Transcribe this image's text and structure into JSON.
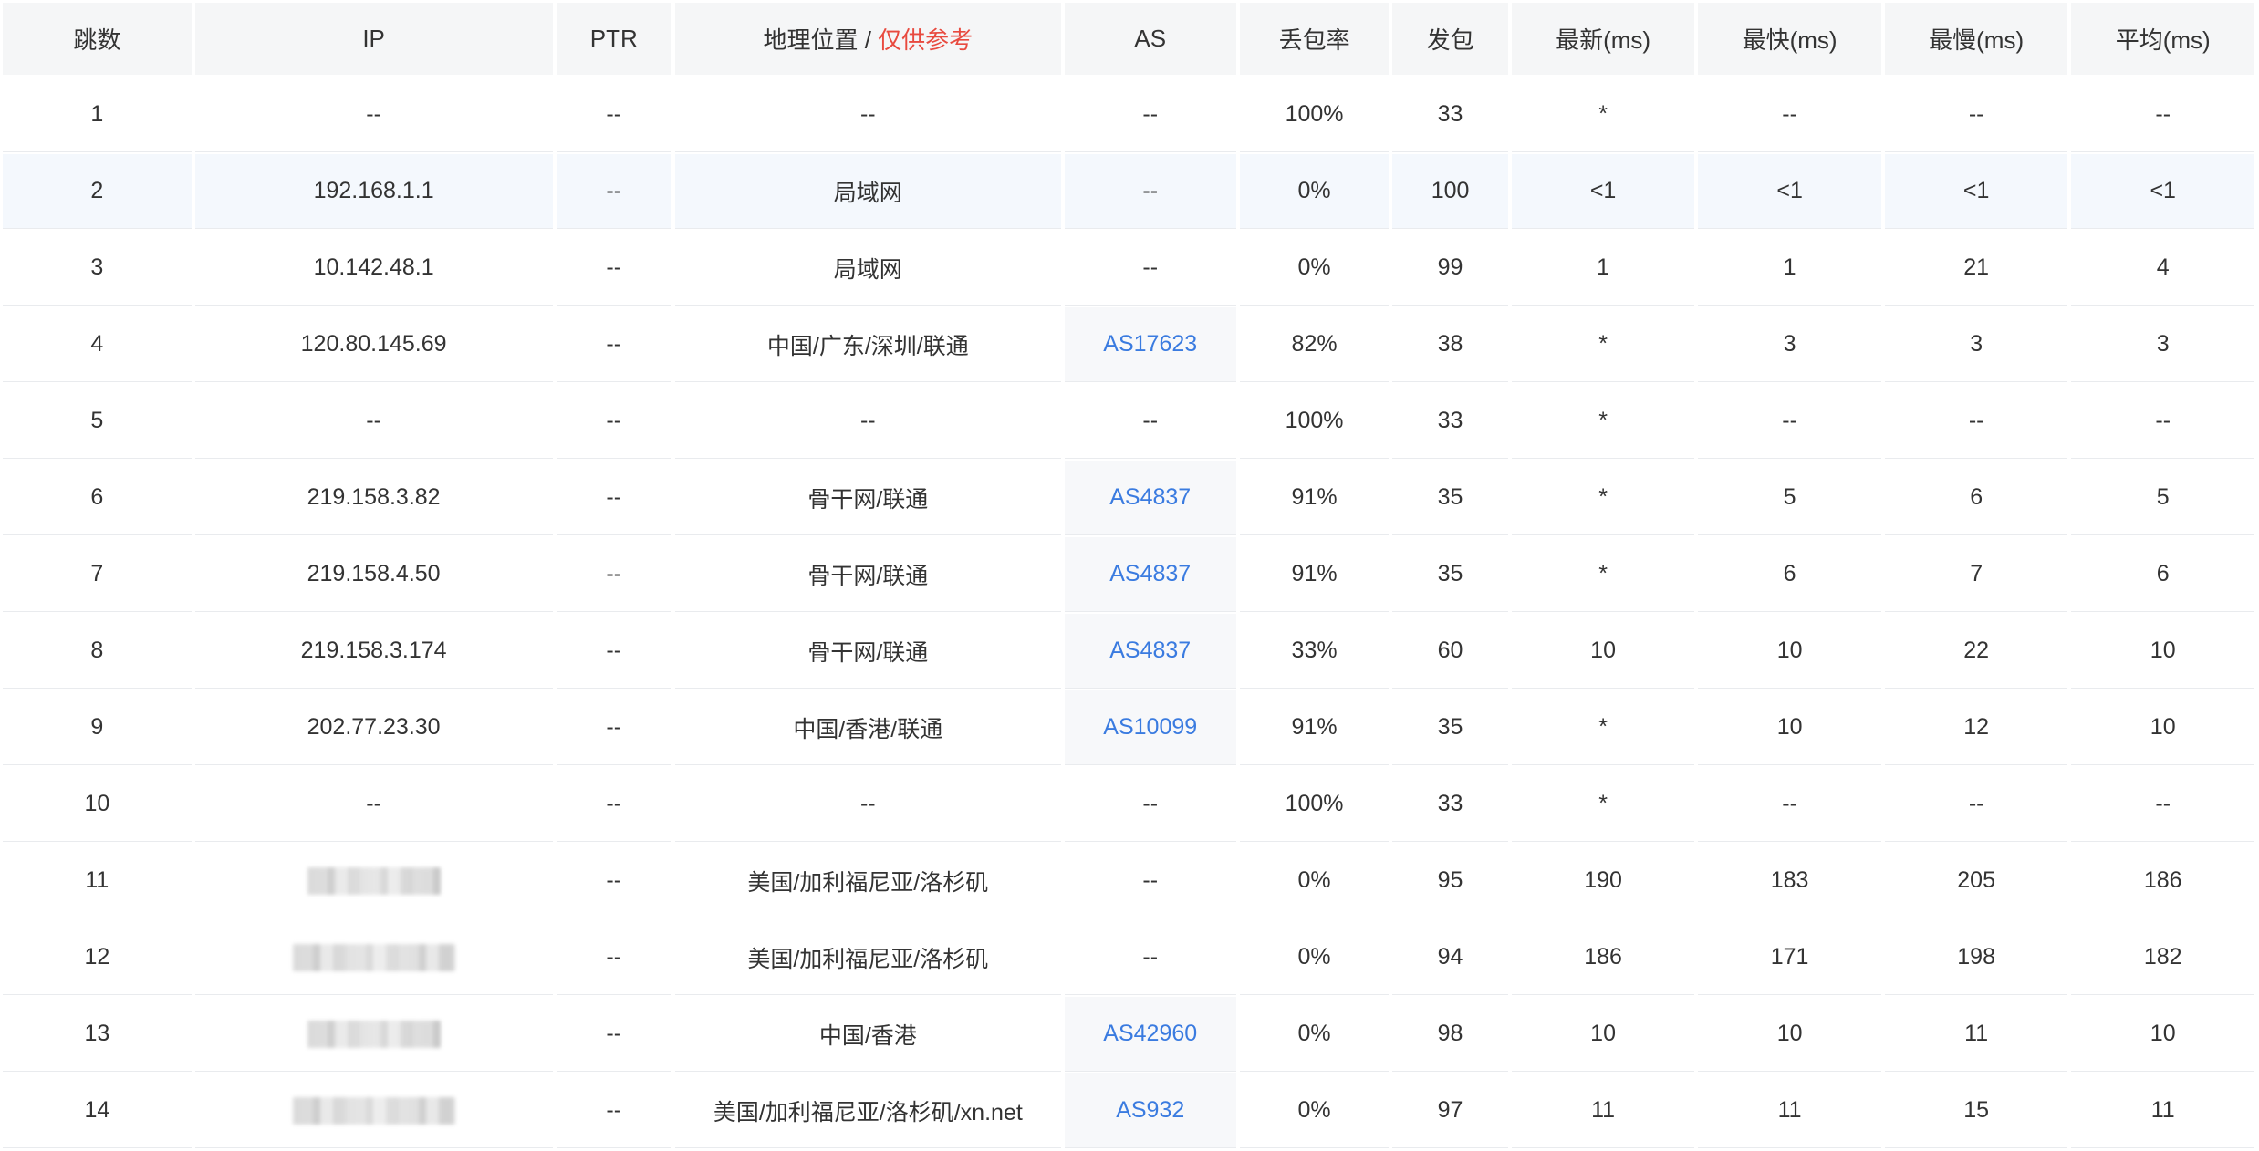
{
  "headers": {
    "hop": "跳数",
    "ip": "IP",
    "ptr": "PTR",
    "geo": "地理位置",
    "geo_sep": " / ",
    "geo_warn": "仅供参考",
    "as": "AS",
    "loss": "丢包率",
    "sent": "发包",
    "last": "最新(ms)",
    "best": "最快(ms)",
    "worst": "最慢(ms)",
    "avg": "平均(ms)"
  },
  "rows": [
    {
      "hop": "1",
      "ip": "--",
      "ptr": "--",
      "geo": "--",
      "as": "--",
      "loss": "100%",
      "sent": "33",
      "last": "*",
      "best": "--",
      "worst": "--",
      "avg": "--"
    },
    {
      "hop": "2",
      "ip": "192.168.1.1",
      "ptr": "--",
      "geo": "局域网",
      "as": "--",
      "loss": "0%",
      "sent": "100",
      "last": "<1",
      "best": "<1",
      "worst": "<1",
      "avg": "<1"
    },
    {
      "hop": "3",
      "ip": "10.142.48.1",
      "ptr": "--",
      "geo": "局域网",
      "as": "--",
      "loss": "0%",
      "sent": "99",
      "last": "1",
      "best": "1",
      "worst": "21",
      "avg": "4"
    },
    {
      "hop": "4",
      "ip": "120.80.145.69",
      "ptr": "--",
      "geo": "中国/广东/深圳/联通",
      "as": "AS17623",
      "loss": "82%",
      "sent": "38",
      "last": "*",
      "best": "3",
      "worst": "3",
      "avg": "3"
    },
    {
      "hop": "5",
      "ip": "--",
      "ptr": "--",
      "geo": "--",
      "as": "--",
      "loss": "100%",
      "sent": "33",
      "last": "*",
      "best": "--",
      "worst": "--",
      "avg": "--"
    },
    {
      "hop": "6",
      "ip": "219.158.3.82",
      "ptr": "--",
      "geo": "骨干网/联通",
      "as": "AS4837",
      "loss": "91%",
      "sent": "35",
      "last": "*",
      "best": "5",
      "worst": "6",
      "avg": "5"
    },
    {
      "hop": "7",
      "ip": "219.158.4.50",
      "ptr": "--",
      "geo": "骨干网/联通",
      "as": "AS4837",
      "loss": "91%",
      "sent": "35",
      "last": "*",
      "best": "6",
      "worst": "7",
      "avg": "6"
    },
    {
      "hop": "8",
      "ip": "219.158.3.174",
      "ptr": "--",
      "geo": "骨干网/联通",
      "as": "AS4837",
      "loss": "33%",
      "sent": "60",
      "last": "10",
      "best": "10",
      "worst": "22",
      "avg": "10"
    },
    {
      "hop": "9",
      "ip": "202.77.23.30",
      "ptr": "--",
      "geo": "中国/香港/联通",
      "as": "AS10099",
      "loss": "91%",
      "sent": "35",
      "last": "*",
      "best": "10",
      "worst": "12",
      "avg": "10"
    },
    {
      "hop": "10",
      "ip": "--",
      "ptr": "--",
      "geo": "--",
      "as": "--",
      "loss": "100%",
      "sent": "33",
      "last": "*",
      "best": "--",
      "worst": "--",
      "avg": "--"
    },
    {
      "hop": "11",
      "ip": "",
      "ptr": "--",
      "geo": "美国/加利福尼亚/洛杉矶",
      "as": "--",
      "loss": "0%",
      "sent": "95",
      "last": "190",
      "best": "183",
      "worst": "205",
      "avg": "186"
    },
    {
      "hop": "12",
      "ip": "",
      "ptr": "--",
      "geo": "美国/加利福尼亚/洛杉矶",
      "as": "--",
      "loss": "0%",
      "sent": "94",
      "last": "186",
      "best": "171",
      "worst": "198",
      "avg": "182"
    },
    {
      "hop": "13",
      "ip": "",
      "ptr": "--",
      "geo": "中国/香港",
      "as": "AS42960",
      "loss": "0%",
      "sent": "98",
      "last": "10",
      "best": "10",
      "worst": "11",
      "avg": "10"
    },
    {
      "hop": "14",
      "ip": "",
      "ptr": "--",
      "geo": "美国/加利福尼亚/洛杉矶/xn.net",
      "as": "AS932",
      "loss": "0%",
      "sent": "97",
      "last": "11",
      "best": "11",
      "worst": "15",
      "avg": "11"
    }
  ],
  "colors": {
    "header_bg": "#f5f6f7",
    "link": "#3a7be0",
    "warn": "#e84a3f",
    "highlight_row": "#f4f8fd"
  }
}
